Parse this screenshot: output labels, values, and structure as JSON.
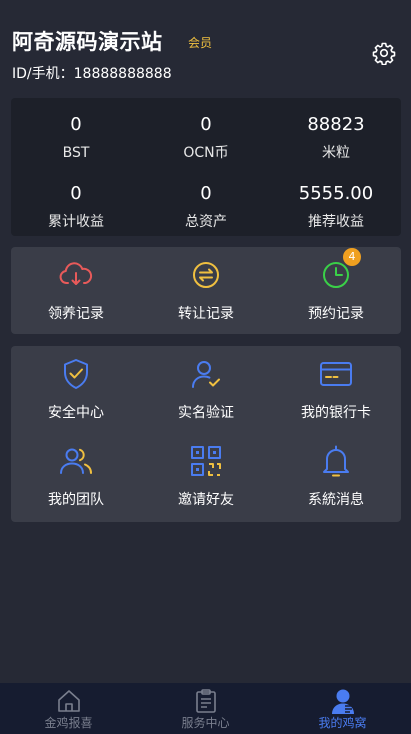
{
  "header": {
    "title": "阿奇源码演示站",
    "member_badge": "会员",
    "user_id": "ID/手机：18888888888",
    "settings_icon": "gear-icon"
  },
  "stats": [
    {
      "value": "0",
      "label": "BST"
    },
    {
      "value": "0",
      "label": "OCN币"
    },
    {
      "value": "88823",
      "label": "米粒"
    },
    {
      "value": "0",
      "label": "累计收益"
    },
    {
      "value": "0",
      "label": "总资产"
    },
    {
      "value": "5555.00",
      "label": "推荐收益"
    }
  ],
  "records": [
    {
      "label": "领养记录",
      "icon": "cloud-download-icon",
      "color": "#e85a5a"
    },
    {
      "label": "转让记录",
      "icon": "transfer-icon",
      "color": "#f0c040"
    },
    {
      "label": "预约记录",
      "icon": "clock-icon",
      "color": "#3ad048",
      "badge": "4"
    }
  ],
  "services": [
    {
      "label": "安全中心",
      "icon": "shield-check-icon"
    },
    {
      "label": "实名验证",
      "icon": "user-verify-icon"
    },
    {
      "label": "我的银行卡",
      "icon": "bank-card-icon"
    },
    {
      "label": "我的团队",
      "icon": "team-icon"
    },
    {
      "label": "邀请好友",
      "icon": "qr-code-icon"
    },
    {
      "label": "系統消息",
      "icon": "bell-icon"
    }
  ],
  "colors": {
    "accent_blue": "#4a7cf0",
    "accent_yellow": "#f0c040",
    "badge": "#f0a020"
  },
  "tabbar": [
    {
      "label": "金鸡报喜",
      "icon": "home-icon"
    },
    {
      "label": "服务中心",
      "icon": "clipboard-icon"
    },
    {
      "label": "我的鸡窝",
      "icon": "user-icon",
      "active": true
    }
  ]
}
